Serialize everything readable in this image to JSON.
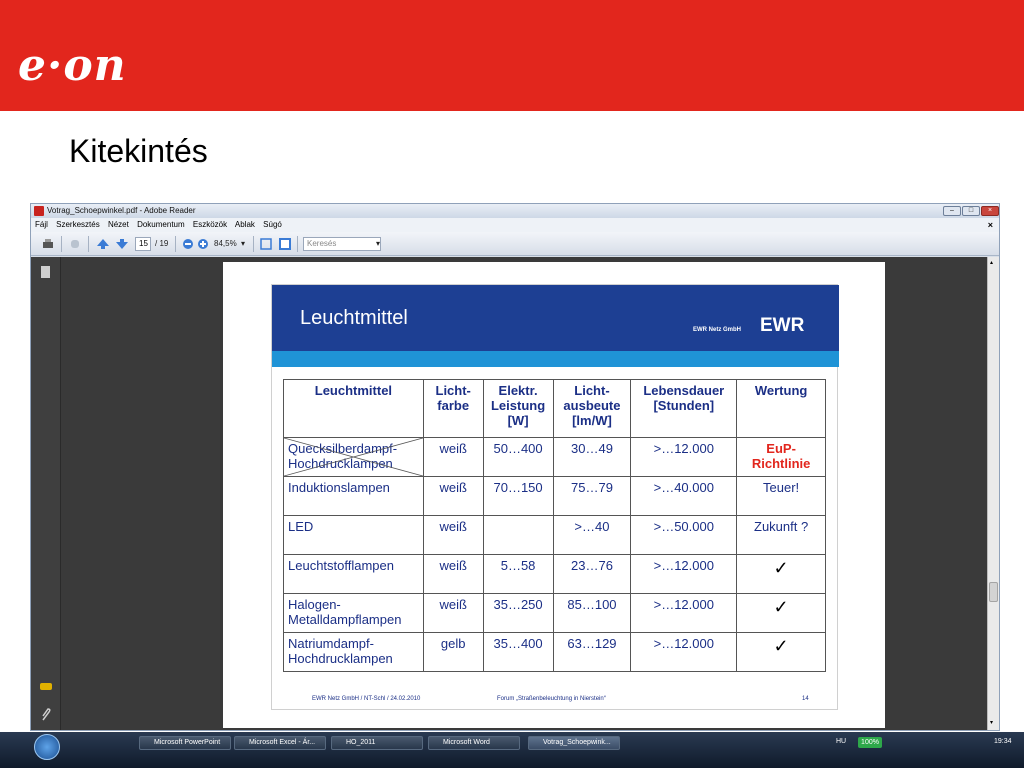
{
  "banner": {
    "logo": "e·on",
    "brand_color": "#e2261d"
  },
  "slide": {
    "title": "Kitekintés"
  },
  "reader": {
    "window_title": "Votrag_Schoepwinkel.pdf - Adobe Reader",
    "menu": [
      "Fájl",
      "Szerkesztés",
      "Nézet",
      "Dokumentum",
      "Eszközök",
      "Ablak",
      "Súgó"
    ],
    "close_mark": "×",
    "toolbar": {
      "page_current": "15",
      "page_total": "/ 19",
      "zoom": "84,5%",
      "search_placeholder": "Keresés"
    }
  },
  "pdf": {
    "heading": "Leuchtmittel",
    "company_small": "EWR Netz GmbH",
    "company_big": "EWR",
    "table": {
      "headers": [
        "Leuchtmittel",
        "Licht-farbe",
        "Elektr. Leistung [W]",
        "Licht-ausbeute [lm/W]",
        "Lebensdauer [Stunden]",
        "Wertung"
      ],
      "rows": [
        [
          "Quecksilberdampf-Hochdrucklampen",
          "weiß",
          "50…400",
          "30…49",
          ">…12.000",
          "EuP-Richtlinie"
        ],
        [
          "Induktionslampen",
          "weiß",
          "70…150",
          "75…79",
          ">…40.000",
          "Teuer!"
        ],
        [
          "LED",
          "weiß",
          "",
          ">…40",
          ">…50.000",
          "Zukunft ?"
        ],
        [
          "Leuchtstofflampen",
          "weiß",
          "5…58",
          "23…76",
          ">…12.000",
          "✓"
        ],
        [
          "Halogen-Metalldampflampen",
          "weiß",
          "35…250",
          "85…100",
          ">…12.000",
          "✓"
        ],
        [
          "Natriumdampf-Hochdrucklampen",
          "gelb",
          "35…400",
          "63…129",
          ">…12.000",
          "✓"
        ]
      ]
    },
    "footer_left": "EWR Netz GmbH / NT-Schl / 24.02.2010",
    "footer_center": "Forum „Straßenbeleuchtung in Nierstein“",
    "footer_right": "14"
  },
  "taskbar": {
    "items": [
      "Microsoft PowerPoint",
      "Microsoft Excel - Ár...",
      "HO_2011",
      "Microsoft Word",
      "Votrag_Schoepwink..."
    ],
    "lang": "HU",
    "battery": "100%",
    "time": "19:34"
  }
}
